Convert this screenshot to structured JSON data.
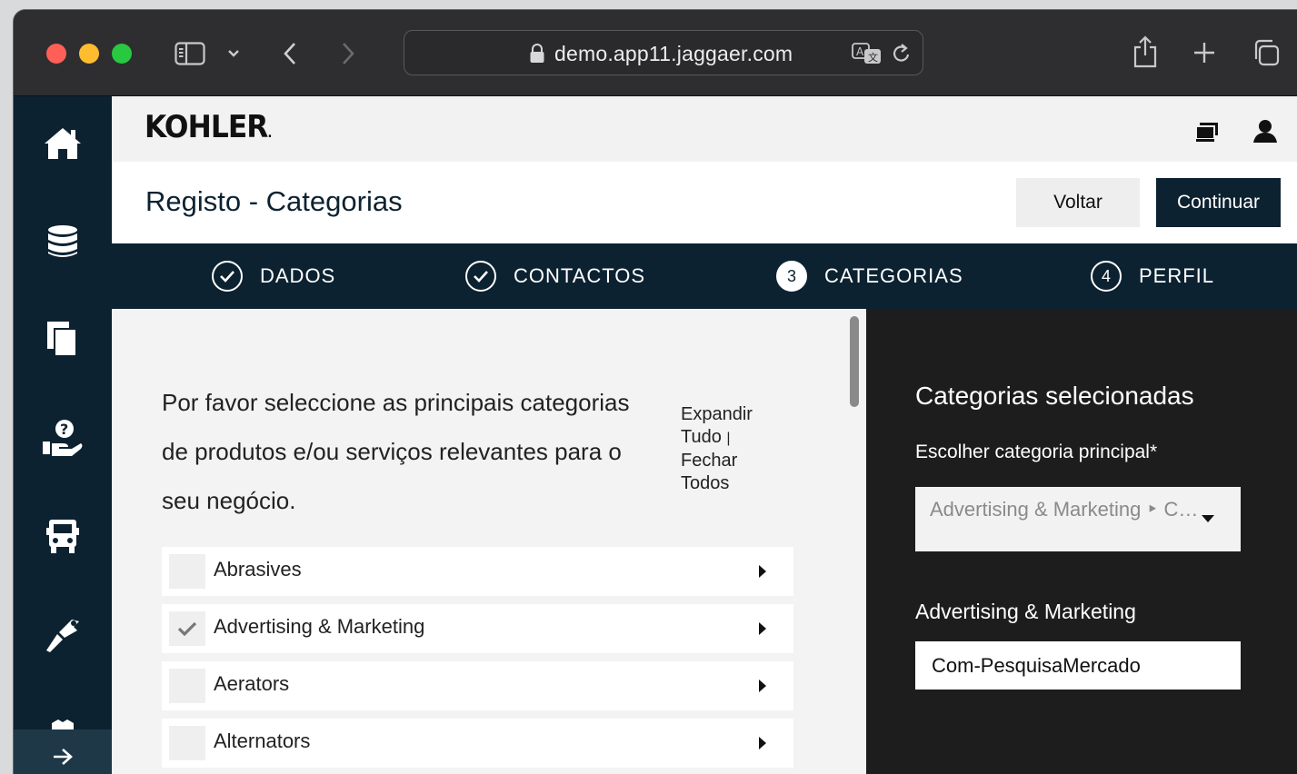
{
  "browser": {
    "url": "demo.app11.jaggaer.com"
  },
  "brand": {
    "logo": "KOHLER",
    "primary_color": "#0c2231"
  },
  "header": {
    "title": "Registo - Categorias",
    "back_label": "Voltar",
    "continue_label": "Continuar"
  },
  "steps": [
    {
      "label": "DADOS",
      "state": "done",
      "marker": ""
    },
    {
      "label": "CONTACTOS",
      "state": "done",
      "marker": ""
    },
    {
      "label": "CATEGORIAS",
      "state": "current",
      "marker": "3"
    },
    {
      "label": "PERFIL",
      "state": "upcoming",
      "marker": "4"
    }
  ],
  "sidebar": {
    "items": [
      "home-icon",
      "database-icon",
      "documents-icon",
      "help-hand-icon",
      "truck-icon",
      "tools-icon"
    ],
    "expand_icon": "arrow-right-icon"
  },
  "main": {
    "intro": "Por favor seleccione as principais categorias de produtos e/ou serviços relevantes para o seu negócio.",
    "expand_all": "Expandir Tudo",
    "separator": "|",
    "collapse_all": "Fechar Todos",
    "categories": [
      {
        "label": "Abrasives",
        "checked": false
      },
      {
        "label": "Advertising & Marketing",
        "checked": true
      },
      {
        "label": "Aerators",
        "checked": false
      },
      {
        "label": "Alternators",
        "checked": false
      }
    ]
  },
  "selected": {
    "title": "Categorias selecionadas",
    "main_label": "Escolher categoria principal*",
    "main_value": "Advertising & Marketing ‣ C…",
    "group_label": "Advertising & Marketing",
    "group_value": "Com-PesquisaMercado"
  }
}
